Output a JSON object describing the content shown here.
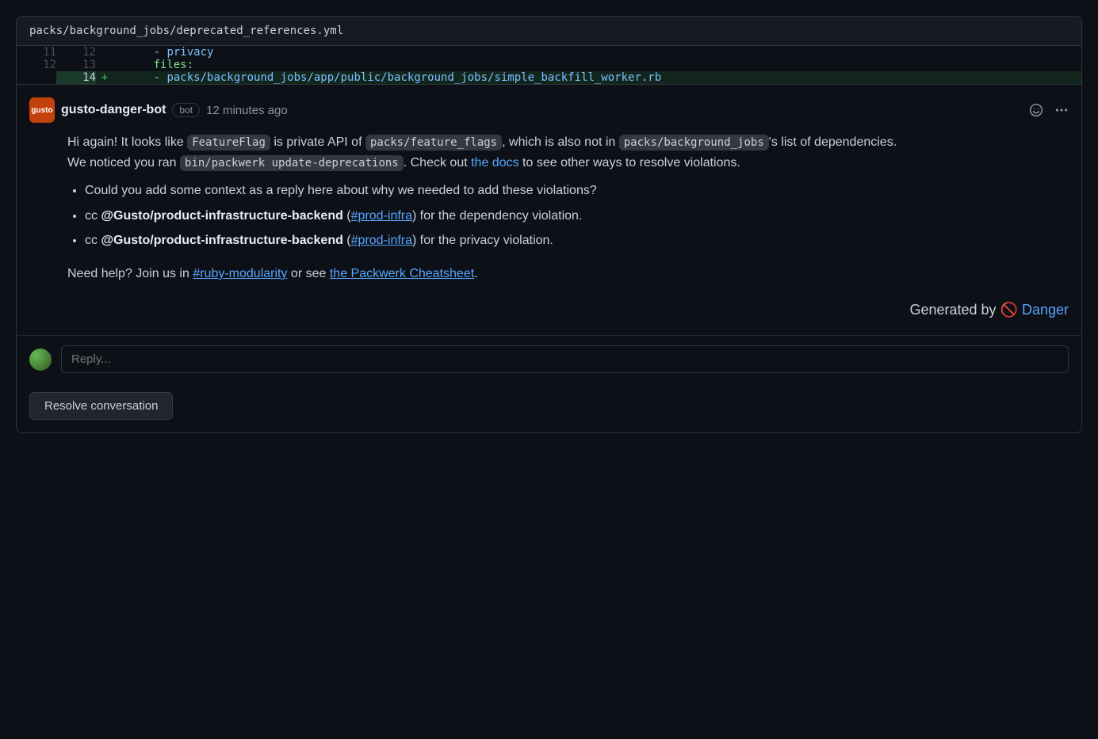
{
  "file": {
    "path": "packs/background_jobs/deprecated_references.yml"
  },
  "diff": {
    "rows": [
      {
        "old": "11",
        "new": "12",
        "marker": "",
        "dash": "- ",
        "text": "privacy",
        "cls": "tok-path"
      },
      {
        "old": "12",
        "new": "13",
        "marker": "",
        "dash": "",
        "text": "files:",
        "cls": "tok-key"
      },
      {
        "old": "",
        "new": "14",
        "marker": "+",
        "dash": "- ",
        "text": "packs/background_jobs/app/public/background_jobs/simple_backfill_worker.rb",
        "cls": "tok-path",
        "addition": true
      }
    ]
  },
  "comment": {
    "avatar_label": "gusto",
    "author": "gusto-danger-bot",
    "bot_badge": "bot",
    "timestamp": "12 minutes ago",
    "p1_a": "Hi again! It looks like ",
    "p1_code1": "FeatureFlag",
    "p1_b": " is private API of ",
    "p1_code2": "packs/feature_flags",
    "p1_c": ", which is also not in ",
    "p1_code3": "packs/background_jobs",
    "p1_d": "'s list of dependencies.",
    "p2_a": "We noticed you ran ",
    "p2_code": "bin/packwerk update-deprecations",
    "p2_b": ". Check out ",
    "p2_link": "the docs",
    "p2_c": " to see other ways to resolve violations.",
    "bullet1": "Could you add some context as a reply here about why we needed to add these violations?",
    "bullet2_a": "cc ",
    "bullet2_mention": "@Gusto/product-infrastructure-backend",
    "bullet2_b": " (",
    "bullet2_link": "#prod-infra",
    "bullet2_c": ") for the dependency violation.",
    "bullet3_a": "cc ",
    "bullet3_mention": "@Gusto/product-infrastructure-backend",
    "bullet3_b": " (",
    "bullet3_link": "#prod-infra",
    "bullet3_c": ") for the privacy violation.",
    "p3_a": "Need help? Join us in ",
    "p3_link1": "#ruby-modularity",
    "p3_b": " or see ",
    "p3_link2": "the Packwerk Cheatsheet",
    "p3_c": ".",
    "generated_prefix": "Generated by ",
    "generated_emoji": "🚫",
    "generated_link": "Danger"
  },
  "reply": {
    "placeholder": "Reply..."
  },
  "resolve": {
    "label": "Resolve conversation"
  }
}
